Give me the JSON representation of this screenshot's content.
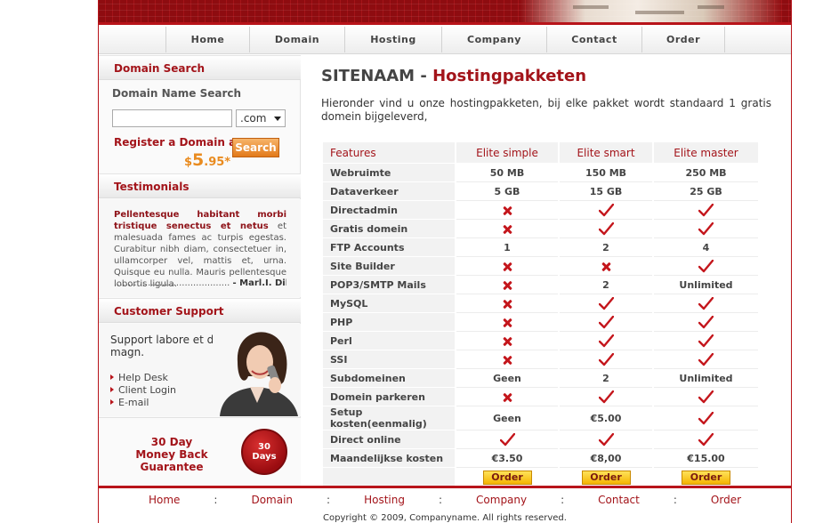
{
  "nav": {
    "items": [
      "Home",
      "Domain",
      "Hosting",
      "Company",
      "Contact",
      "Order"
    ]
  },
  "sidebar": {
    "domain_search": {
      "heading": "Domain Search",
      "label": "Domain Name Search",
      "input_value": "",
      "extension": ".com",
      "register_text": "Register a Domain at",
      "price_currency": "$",
      "price_whole": "5",
      "price_cents": ".95*",
      "search_button": "Search"
    },
    "testimonials": {
      "heading": "Testimonials",
      "highlight": "Pellentesque habitant morbi tristique senectus et netus",
      "body": " et malesuada fames ac turpis egestas. Curabitur nibh diam, consectetuer in, ullamcorper vel, mattis et, urna. Quisque eu nulla. Mauris pellentesque lobortis ligula.",
      "dots": ".........................................",
      "author": "- Marl.I. Dilama"
    },
    "support": {
      "heading": "Customer Support",
      "text": "Support labore et dolore magn.",
      "links": [
        "Help Desk",
        "Client Login",
        "E-mail"
      ]
    },
    "guarantee": {
      "line1": "30 Day",
      "line2": "Money Back Guarantee",
      "badge_num": "30",
      "badge_word": "Days"
    }
  },
  "content": {
    "site_name": "SITENAAM",
    "separator": " - ",
    "page_title": "Hostingpakketen",
    "intro": "Hieronder vind u onze hostingpakketen, bij elke pakket wordt standaard 1 gratis domein bijgeleverd,"
  },
  "pricing": {
    "features_header": "Features",
    "plans": [
      "Elite simple",
      "Elite smart",
      "Elite master"
    ],
    "rows": [
      {
        "feature": "Webruimte",
        "values": [
          "50 MB",
          "150 MB",
          "250 MB"
        ]
      },
      {
        "feature": "Dataverkeer",
        "values": [
          "5 GB",
          "15 GB",
          "25 GB"
        ]
      },
      {
        "feature": "Directadmin",
        "values": [
          "no",
          "yes",
          "yes"
        ]
      },
      {
        "feature": "Gratis domein",
        "values": [
          "no",
          "yes",
          "yes"
        ]
      },
      {
        "feature": "FTP Accounts",
        "values": [
          "1",
          "2",
          "4"
        ]
      },
      {
        "feature": "Site Builder",
        "values": [
          "no",
          "no",
          "yes"
        ]
      },
      {
        "feature": "POP3/SMTP Mails",
        "values": [
          "no",
          "2",
          "Unlimited"
        ]
      },
      {
        "feature": "MySQL",
        "values": [
          "no",
          "yes",
          "yes"
        ]
      },
      {
        "feature": "PHP",
        "values": [
          "no",
          "yes",
          "yes"
        ]
      },
      {
        "feature": "Perl",
        "values": [
          "no",
          "yes",
          "yes"
        ]
      },
      {
        "feature": "SSI",
        "values": [
          "no",
          "yes",
          "yes"
        ]
      },
      {
        "feature": "Subdomeinen",
        "values": [
          "Geen",
          "2",
          "Unlimited"
        ]
      },
      {
        "feature": "Domein parkeren",
        "values": [
          "no",
          "yes",
          "yes"
        ]
      },
      {
        "feature": "Setup kosten(eenmalig)",
        "values": [
          "Geen",
          "€5.00",
          "yes"
        ]
      },
      {
        "feature": "Direct online",
        "values": [
          "yes",
          "yes",
          "yes"
        ]
      },
      {
        "feature": "Maandelijkse kosten",
        "values": [
          "€3.50",
          "€8,00",
          "€15.00"
        ]
      }
    ],
    "order_label": "Order",
    "colors": {
      "accent": "#a3141a",
      "check": "#c4161c",
      "order": "#f4b400"
    }
  },
  "footer": {
    "links": [
      "Home",
      "Domain",
      "Hosting",
      "Company",
      "Contact",
      "Order"
    ],
    "separator": ":",
    "copyright": "Copyright © 2009, Companyname. All rights reserved."
  }
}
